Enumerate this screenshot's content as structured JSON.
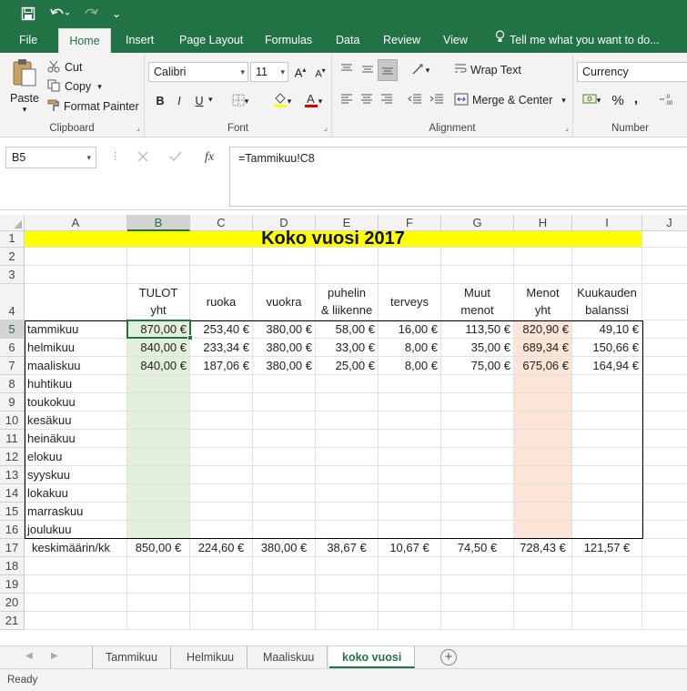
{
  "quick_access": {
    "more": "⌄"
  },
  "ribbon_tabs": [
    "File",
    "Home",
    "Insert",
    "Page Layout",
    "Formulas",
    "Data",
    "Review",
    "View"
  ],
  "tell_me": "Tell me what you want to do...",
  "clipboard": {
    "paste": "Paste",
    "cut": "Cut",
    "copy": "Copy",
    "format_painter": "Format Painter",
    "label": "Clipboard"
  },
  "font": {
    "name": "Calibri",
    "size": "11",
    "bold": "B",
    "italic": "I",
    "underline": "U",
    "label": "Font"
  },
  "alignment": {
    "wrap": "Wrap Text",
    "merge": "Merge & Center",
    "label": "Alignment"
  },
  "number": {
    "format": "Currency",
    "percent": "%",
    "comma": ",",
    "label": "Number"
  },
  "formula_bar": {
    "name_box": "B5",
    "fx": "fx",
    "formula": "=Tammikuu!C8"
  },
  "columns": [
    "A",
    "B",
    "C",
    "D",
    "E",
    "F",
    "G",
    "H",
    "I",
    "J"
  ],
  "rows": [
    "1",
    "2",
    "3",
    "4",
    "5",
    "6",
    "7",
    "8",
    "9",
    "10",
    "11",
    "12",
    "13",
    "14",
    "15",
    "16",
    "17",
    "18",
    "19",
    "20",
    "21"
  ],
  "sheet": {
    "title": "Koko vuosi 2017",
    "headers": {
      "B": [
        "TULOT",
        "yht"
      ],
      "C": [
        "ruoka"
      ],
      "D": [
        "vuokra"
      ],
      "E": [
        "puhelin",
        "& liikenne"
      ],
      "F": [
        "terveys"
      ],
      "G": [
        "Muut",
        "menot"
      ],
      "H": [
        "Menot",
        "yht"
      ],
      "I": [
        "Kuukauden",
        "balanssi"
      ]
    },
    "months": [
      "tammikuu",
      "helmikuu",
      "maaliskuu",
      "huhtikuu",
      "toukokuu",
      "kesäkuu",
      "heinäkuu",
      "elokuu",
      "syyskuu",
      "lokakuu",
      "marraskuu",
      "joulukuu"
    ],
    "data": [
      [
        "870,00 €",
        "253,40 €",
        "380,00 €",
        "58,00 €",
        "16,00 €",
        "113,50 €",
        "820,90 €",
        "49,10 €"
      ],
      [
        "840,00 €",
        "233,34 €",
        "380,00 €",
        "33,00 €",
        "8,00 €",
        "35,00 €",
        "689,34 €",
        "150,66 €"
      ],
      [
        "840,00 €",
        "187,06 €",
        "380,00 €",
        "25,00 €",
        "8,00 €",
        "75,00 €",
        "675,06 €",
        "164,94 €"
      ]
    ],
    "avg_label": "keskimäärin/kk",
    "averages": [
      "850,00 €",
      "224,60 €",
      "380,00 €",
      "38,67 €",
      "10,67 €",
      "74,50 €",
      "728,43 €",
      "121,57 €"
    ]
  },
  "sheet_tabs": [
    "Tammikuu",
    "Helmikuu",
    "Maaliskuu",
    "koko vuosi"
  ],
  "active_sheet": "koko vuosi",
  "status": "Ready",
  "colors": {
    "brand": "#217346",
    "title_fill": "#ffff00",
    "income_fill": "#e2efda",
    "expense_fill": "#fce4d6"
  }
}
